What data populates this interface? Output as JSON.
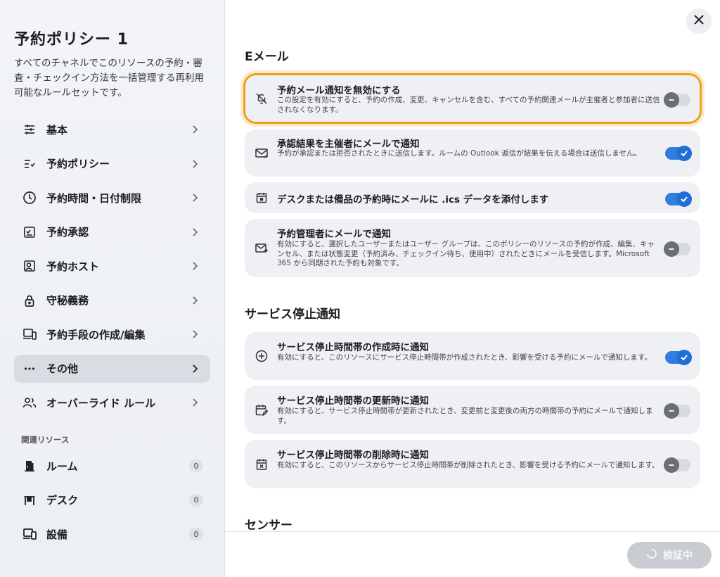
{
  "sidebar": {
    "title": "予約ポリシー 1",
    "description": "すべてのチャネルでこのリソースの予約・審査・チェックイン方法を一括管理する再利用可能なルールセットです。",
    "nav": [
      {
        "label": "基本",
        "icon": "sliders-icon"
      },
      {
        "label": "予約ポリシー",
        "icon": "list-check-icon"
      },
      {
        "label": "予約時間・日付制限",
        "icon": "clock-icon"
      },
      {
        "label": "予約承認",
        "icon": "approval-icon"
      },
      {
        "label": "予約ホスト",
        "icon": "host-icon"
      },
      {
        "label": "守秘義務",
        "icon": "lock-icon"
      },
      {
        "label": "予約手段の作成/編集",
        "icon": "devices-icon"
      },
      {
        "label": "その他",
        "icon": "more-icon",
        "active": true
      },
      {
        "label": "オーバーライド ルール",
        "icon": "people-icon"
      }
    ],
    "related_label": "関連リソース",
    "resources": [
      {
        "label": "ルーム",
        "count": "0",
        "icon": "door-icon"
      },
      {
        "label": "デスク",
        "count": "0",
        "icon": "desk-icon"
      },
      {
        "label": "設備",
        "count": "0",
        "icon": "equipment-icon"
      }
    ]
  },
  "main": {
    "email_section": "Eメール",
    "email_cards": [
      {
        "title": "予約メール通知を無効にする",
        "desc": "この設定を有効にすると、予約の作成、変更、キャンセルを含む、すべての予約関連メールが主催者と参加者に送信されなくなります。",
        "toggle": "off",
        "icon": "bell-off-icon"
      },
      {
        "title": "承認結果を主催者にメールで通知",
        "desc": "予約が承認または拒否されたときに送信します。ルームの Outlook 返信が結果を伝える場合は送信しません。",
        "toggle": "on",
        "icon": "mail-check-icon"
      },
      {
        "title": "デスクまたは備品の予約時にメールに .ics データを添付します",
        "desc": "",
        "toggle": "on",
        "icon": "calendar-icon"
      },
      {
        "title": "予約管理者にメールで通知",
        "desc": "有効にすると、選択したユーザーまたはユーザー グループは、このポリシーのリソースの予約が作成、編集、キャンセル、または状態変更（予約済み、チェックイン待ち、使用中）されたときにメールを受信します。Microsoft 365 から同期された予約も対象です。",
        "toggle": "off",
        "icon": "mail-forward-icon"
      }
    ],
    "outage_section": "サービス停止通知",
    "outage_cards": [
      {
        "title": "サービス停止時間帯の作成時に通知",
        "desc": "有効にすると、このリソースにサービス停止時間帯が作成されたとき、影響を受ける予約にメールで通知します。",
        "toggle": "on",
        "icon": "plus-circle-icon"
      },
      {
        "title": "サービス停止時間帯の更新時に通知",
        "desc": "有効にすると、サービス停止時間帯が更新されたとき、変更前と変更後の両方の時間帯の予約にメールで通知します。",
        "toggle": "off",
        "icon": "calendar-edit-icon"
      },
      {
        "title": "サービス停止時間帯の削除時に通知",
        "desc": "有効にすると、このリソースからサービス停止時間帯が削除されたとき、影響を受ける予約にメールで通知します。",
        "toggle": "off",
        "icon": "calendar-x-icon"
      }
    ],
    "sensor_section": "センサー"
  },
  "footer": {
    "verify_label": "検証中"
  },
  "colors": {
    "accent": "#2f7ee0",
    "highlight": "#f0a020"
  }
}
